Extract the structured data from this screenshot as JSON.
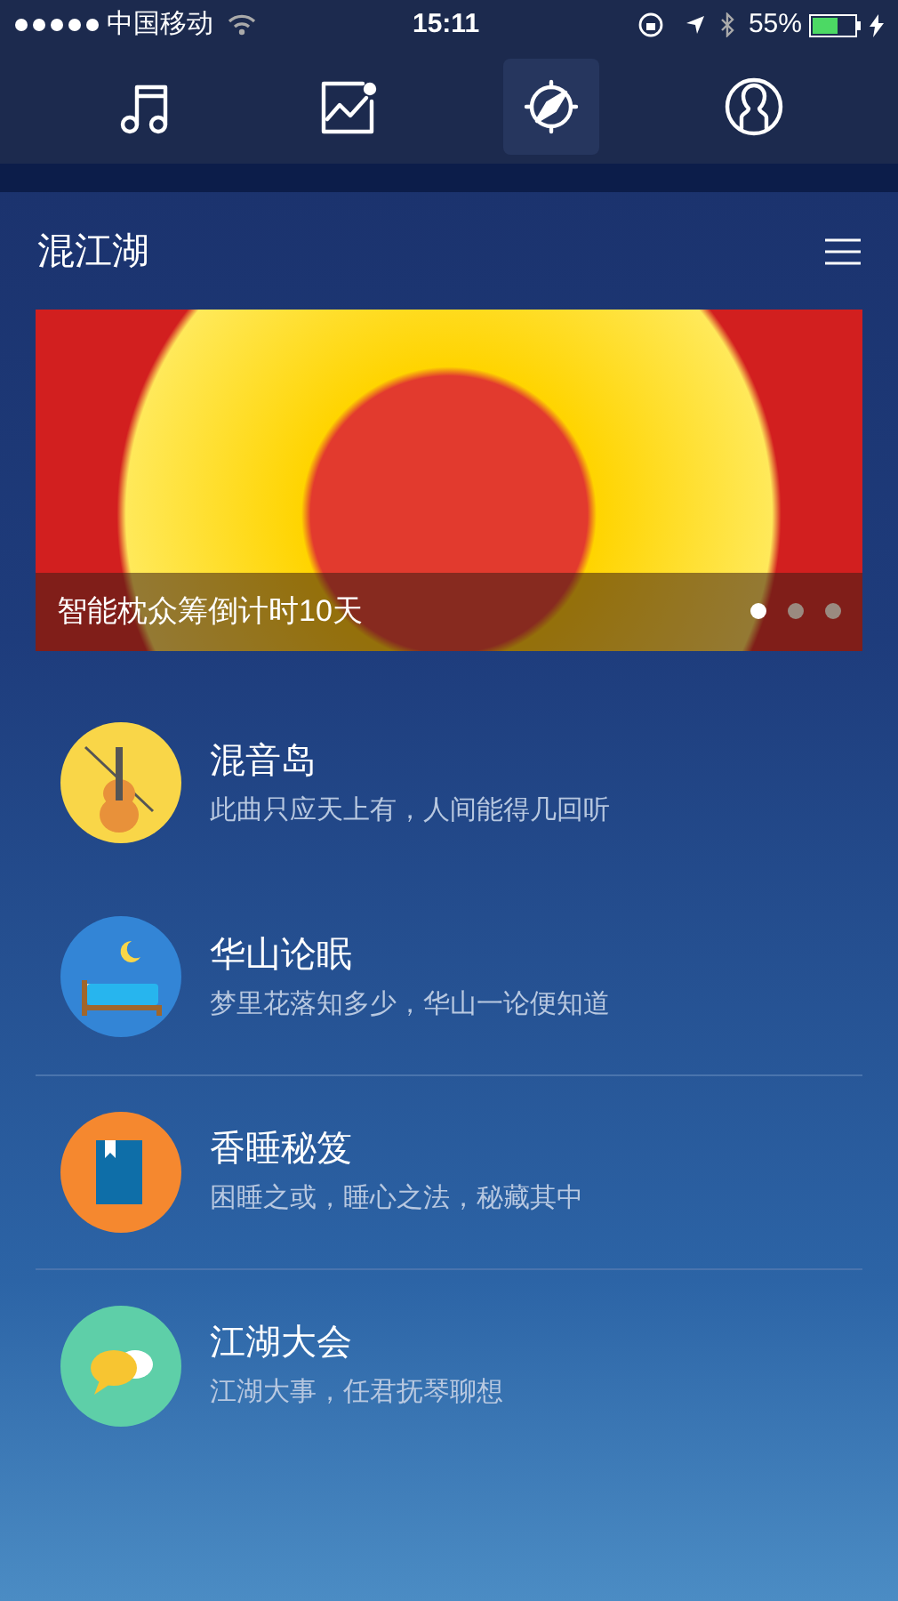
{
  "status_bar": {
    "carrier": "中国移动",
    "time": "15:11",
    "battery": "55%"
  },
  "nav_tabs": [
    {
      "kind": "music",
      "selected": false
    },
    {
      "kind": "chart",
      "selected": false
    },
    {
      "kind": "compass",
      "selected": true
    },
    {
      "kind": "profile",
      "selected": false
    }
  ],
  "header": {
    "title": "混江湖"
  },
  "banner": {
    "caption": "智能枕众筹倒计时10天",
    "dots": [
      {
        "selected": true
      },
      {
        "selected": false
      },
      {
        "selected": false
      }
    ]
  },
  "items": [
    {
      "title": "混音岛",
      "subtitle": "此曲只应天上有，人间能得几回听",
      "kind": "violin",
      "color": "#f9d648",
      "divider_above": false
    },
    {
      "title": "华山论眠",
      "subtitle": "梦里花落知多少，华山一论便知道",
      "kind": "bed",
      "color": "#3385d6",
      "divider_above": false
    },
    {
      "title": "香睡秘笈",
      "subtitle": "困睡之或，睡心之法，秘藏其中",
      "kind": "book",
      "color": "#f5882f",
      "divider_above": true
    },
    {
      "title": "江湖大会",
      "subtitle": "江湖大事，任君抚琴聊想",
      "kind": "chat",
      "color": "#5ecfa8",
      "divider_above": true
    }
  ]
}
